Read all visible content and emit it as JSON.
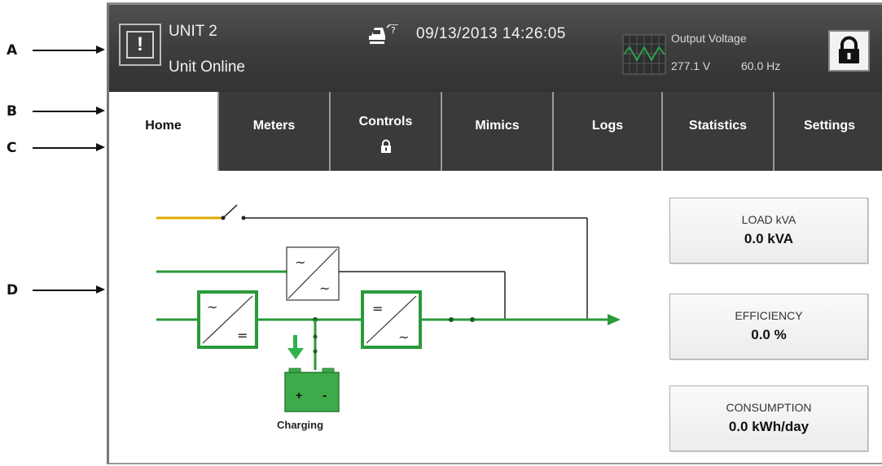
{
  "callouts": [
    "A",
    "B",
    "C",
    "D"
  ],
  "header": {
    "unit_name": "UNIT 2",
    "unit_status": "Unit Online",
    "alarm_glyph": "!",
    "datetime": "09/13/2013 14:26:05",
    "output_label": "Output Voltage",
    "output_volts": "277.1 V",
    "output_hz": "60.0 Hz"
  },
  "tabs": [
    {
      "label": "Home",
      "active": true
    },
    {
      "label": "Meters"
    },
    {
      "label": "Controls",
      "locked": true
    },
    {
      "label": "Mimics"
    },
    {
      "label": "Logs"
    },
    {
      "label": "Statistics"
    },
    {
      "label": "Settings"
    }
  ],
  "diagram": {
    "battery_status": "Charging",
    "battery_plus": "+",
    "battery_minus": "-"
  },
  "metrics": [
    {
      "label": "LOAD kVA",
      "value": "0.0 kVA"
    },
    {
      "label": "EFFICIENCY",
      "value": "0.0 %"
    },
    {
      "label": "CONSUMPTION",
      "value": "0.0 kWh/day"
    }
  ],
  "colors": {
    "power_line": "#2a9a3a",
    "bypass_line": "#e0a800",
    "battery_fill": "#3cab4a",
    "header_bg": "#3d3d3d"
  },
  "icons": [
    "alarm-icon",
    "help-icon",
    "waveform-icon",
    "lock-icon",
    "tab-lock-icon",
    "rectifier-icon",
    "inverter-icon",
    "battery-icon",
    "charge-arrow-icon"
  ]
}
